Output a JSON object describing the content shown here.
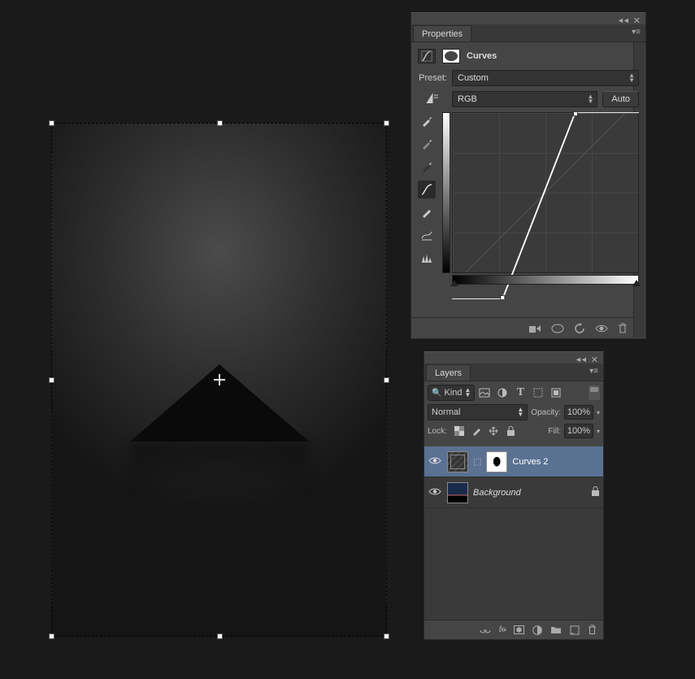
{
  "properties_panel": {
    "tab_label": "Properties",
    "adjustment_title": "Curves",
    "preset_label": "Preset:",
    "preset_value": "Custom",
    "channel_value": "RGB",
    "auto_button": "Auto",
    "curve_points": [
      {
        "x": 0.27,
        "y": 1.0
      },
      {
        "x": 0.66,
        "y": 0.0
      }
    ],
    "footer_icons": [
      "clip-to-layer-icon",
      "preview-toggle-icon",
      "reset-icon",
      "visibility-icon",
      "delete-icon"
    ]
  },
  "layers_panel": {
    "tab_label": "Layers",
    "kind_label": "Kind",
    "blend_mode": "Normal",
    "opacity_label": "Opacity:",
    "opacity_value": "100%",
    "lock_label": "Lock:",
    "fill_label": "Fill:",
    "fill_value": "100%",
    "layers": [
      {
        "name": "Curves 2",
        "selected": true,
        "type": "adjustment-curves",
        "locked": false
      },
      {
        "name": "Background",
        "selected": false,
        "type": "background",
        "locked": true
      }
    ],
    "footer_icons": [
      "link-layers-icon",
      "fx-icon",
      "add-mask-icon",
      "new-adjustment-icon",
      "new-group-icon",
      "new-layer-icon",
      "delete-layer-icon"
    ]
  }
}
